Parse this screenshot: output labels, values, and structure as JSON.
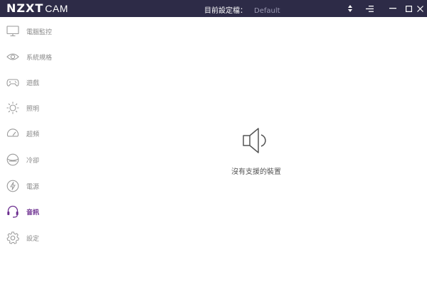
{
  "app": {
    "logo_main": "NZXT",
    "logo_sub": "CAM"
  },
  "titlebar": {
    "profile_label": "目前設定檔：",
    "profile_value": "Default",
    "icons": [
      "sort-arrows-icon",
      "menu-icon",
      "minimize-icon",
      "maximize-icon",
      "close-icon"
    ]
  },
  "sidebar": {
    "items": [
      {
        "label": "電腦監控",
        "icon": "monitor-icon"
      },
      {
        "label": "系統規格",
        "icon": "eye-icon"
      },
      {
        "label": "遊戲",
        "icon": "gamepad-icon"
      },
      {
        "label": "照明",
        "icon": "sun-icon"
      },
      {
        "label": "超頻",
        "icon": "speedometer-icon"
      },
      {
        "label": "冷卻",
        "icon": "fan-icon"
      },
      {
        "label": "電源",
        "icon": "lightning-icon"
      },
      {
        "label": "音訊",
        "icon": "headset-icon",
        "active": true
      },
      {
        "label": "設定",
        "icon": "gear-icon"
      }
    ]
  },
  "main": {
    "empty_icon": "speaker-icon",
    "empty_message": "沒有支援的裝置"
  },
  "colors": {
    "titlebar_bg": "#2d2b47",
    "accent": "#6b2d8f",
    "icon_gray": "#9a9a9a",
    "text_gray": "#8a8a8a"
  }
}
